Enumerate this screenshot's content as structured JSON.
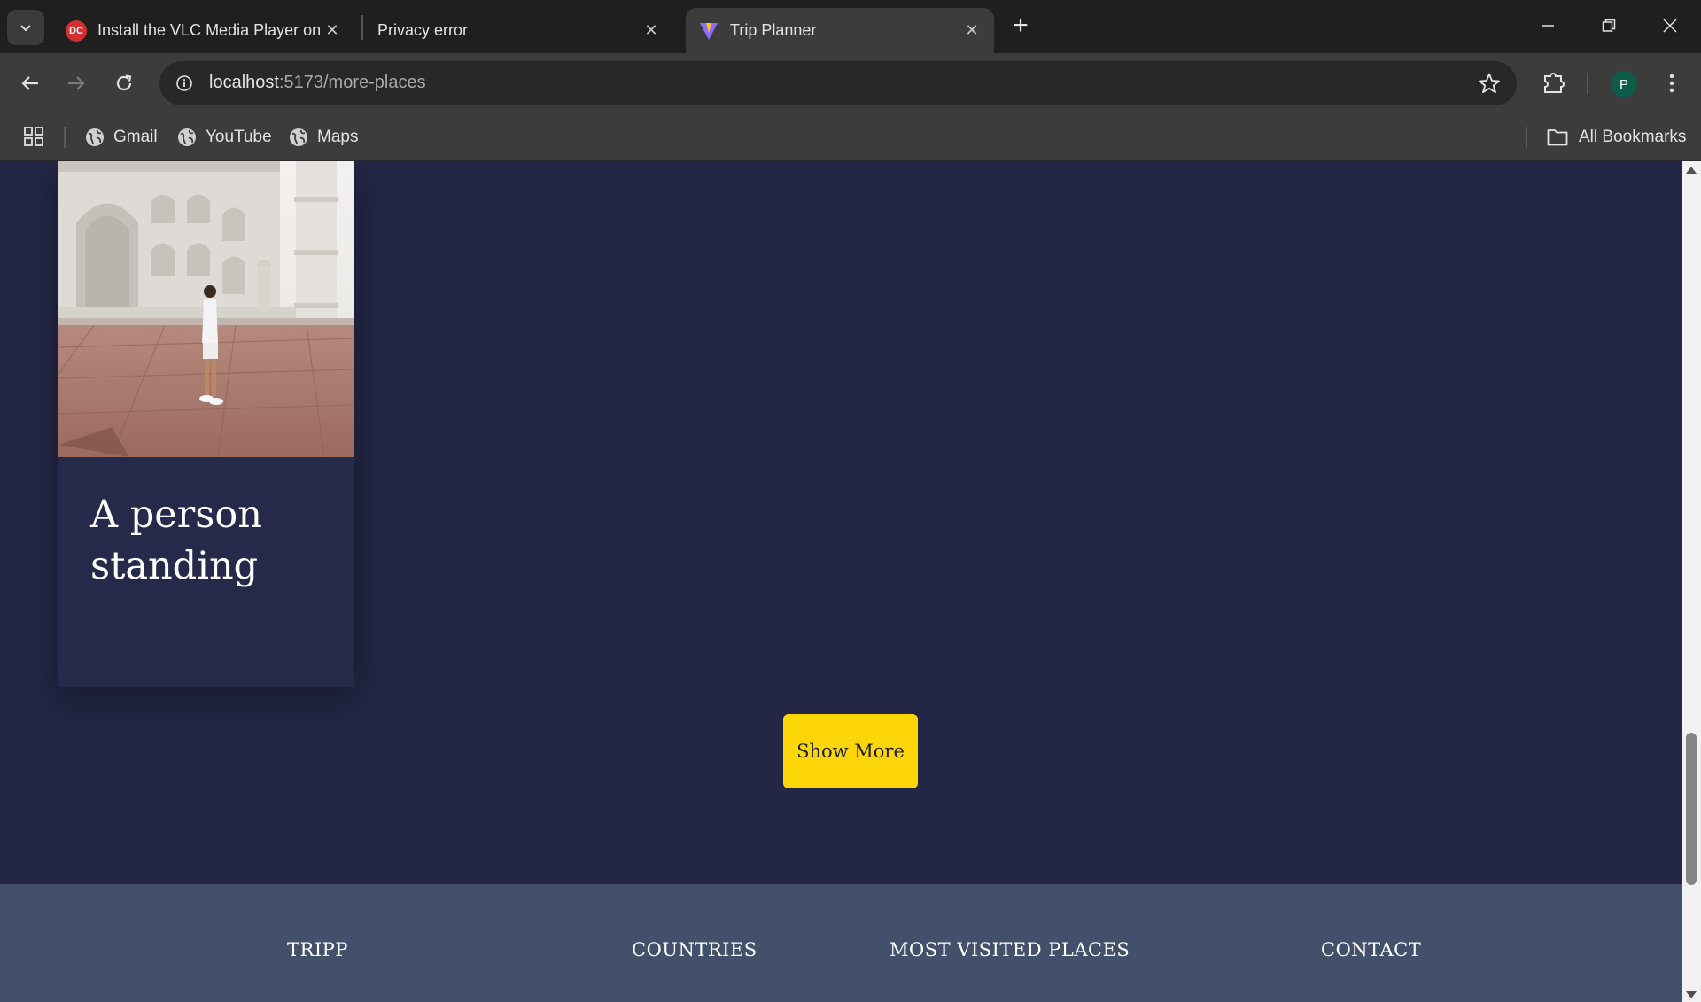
{
  "browser": {
    "tabs": [
      {
        "title": "Install the VLC Media Player on",
        "active": false
      },
      {
        "title": "Privacy error",
        "active": false
      },
      {
        "title": "Trip Planner",
        "active": true
      }
    ],
    "url_host": "localhost",
    "url_path": ":5173/more-places",
    "profile_initial": "P",
    "bookmarks": [
      {
        "label": "Gmail"
      },
      {
        "label": "YouTube"
      },
      {
        "label": "Maps"
      }
    ],
    "all_bookmarks_label": "All Bookmarks"
  },
  "main": {
    "card": {
      "title": "A person standing",
      "image_icon": "taj-mahal-photo"
    },
    "show_more_label": "Show More"
  },
  "footer": {
    "columns": [
      {
        "heading": "TRIPP"
      },
      {
        "heading": "COUNTRIES"
      },
      {
        "heading": "MOST VISITED PLACES"
      },
      {
        "heading": "CONTACT"
      }
    ]
  },
  "colors": {
    "page_bg": "#232745",
    "footer_bg": "#42506c",
    "button_bg": "#fdd60a"
  }
}
